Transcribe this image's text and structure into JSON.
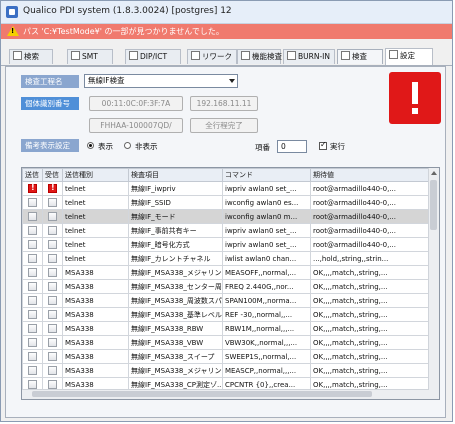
{
  "window": {
    "title": "Qualico PDI system (1.8.3.0024) [postgres] 12"
  },
  "alert": {
    "message": "パス 'C:¥TestMode¥' の一部が見つかりませんでした。"
  },
  "tabs": [
    {
      "label": "検索"
    },
    {
      "label": "SMT"
    },
    {
      "label": "DIP/ICT"
    },
    {
      "label": "リワーク"
    },
    {
      "label": "機能検査"
    },
    {
      "label": "BURN-IN"
    },
    {
      "label": "検査"
    },
    {
      "label": "設定"
    }
  ],
  "form": {
    "process_label": "検査工程名",
    "process_value": "無線IF検査",
    "individual_label": "個体識別番号",
    "mac_address": "00:11:0C:0F:3F:7A",
    "ip_address": "192.168.11.11",
    "serial": "FHHAA-100007QD/",
    "complete_button": "全行程完了",
    "note_label": "備考表示設定",
    "radio_show": "表示",
    "radio_hide": "非表示",
    "count_label": "項番",
    "count_value": "0",
    "run_label": "実行"
  },
  "colors": {
    "alert": "#f07a6e",
    "warning": "#e01818",
    "label_bg": "#8aa6cf"
  },
  "table": {
    "columns": [
      "送信",
      "受信",
      "送信種別",
      "検査項目",
      "コマンド",
      "期待値"
    ],
    "rows": [
      {
        "send_err": true,
        "type": "telnet",
        "item": "無線IF_iwpriv",
        "cmd": "iwpriv awlan0 set_...",
        "expect": "root@armadillo440-0,..."
      },
      {
        "send_err": false,
        "type": "telnet",
        "item": "無線IF_SSID",
        "cmd": "iwconfig awlan0 es...",
        "expect": "root@armadillo440-0,..."
      },
      {
        "send_err": false,
        "type": "telnet",
        "item": "無線IF_モード",
        "cmd": "iwconfig awlan0 m...",
        "expect": "root@armadillo440-0,..."
      },
      {
        "send_err": false,
        "type": "telnet",
        "item": "無線IF_事前共有キー",
        "cmd": "iwpriv awlan0 set_...",
        "expect": "root@armadillo440-0,..."
      },
      {
        "send_err": false,
        "type": "telnet",
        "item": "無線IF_暗号化方式",
        "cmd": "iwpriv awlan0 set_...",
        "expect": "root@armadillo440-0,..."
      },
      {
        "send_err": false,
        "type": "telnet",
        "item": "無線IF_カレントチャネル",
        "cmd": "iwlist awlan0 chan...",
        "expect": "...,hold,,string,,strin..."
      },
      {
        "send_err": false,
        "type": "MSA338",
        "item": "無線IF_MSA338_メジャリン...",
        "cmd": "MEASOFF,,normal,...",
        "expect": "OK,,,,match,,string,..."
      },
      {
        "send_err": false,
        "type": "MSA338",
        "item": "無線IF_MSA338_センター周波数",
        "cmd": "FREQ 2.440G,,nor...",
        "expect": "OK,,,,match,,string,..."
      },
      {
        "send_err": false,
        "type": "MSA338",
        "item": "無線IF_MSA338_周波数スパン",
        "cmd": "SPAN100M,,norma...",
        "expect": "OK,,,,match,,string,..."
      },
      {
        "send_err": false,
        "type": "MSA338",
        "item": "無線IF_MSA338_基準レベル",
        "cmd": "REF -30,,normal,,...",
        "expect": "OK,,,,match,,string,..."
      },
      {
        "send_err": false,
        "type": "MSA338",
        "item": "無線IF_MSA338_RBW",
        "cmd": "RBW1M,,normal,,,...",
        "expect": "OK,,,,match,,string,..."
      },
      {
        "send_err": false,
        "type": "MSA338",
        "item": "無線IF_MSA338_VBW",
        "cmd": "VBW30K,,normal,,,...",
        "expect": "OK,,,,match,,string,..."
      },
      {
        "send_err": false,
        "type": "MSA338",
        "item": "無線IF_MSA338_スイープ",
        "cmd": "SWEEP1S,,normal,...",
        "expect": "OK,,,,match,,string,..."
      },
      {
        "send_err": false,
        "type": "MSA338",
        "item": "無線IF_MSA338_メジャリン...",
        "cmd": "MEASCP,,normal,,,...",
        "expect": "OK,,,,match,,string,..."
      },
      {
        "send_err": false,
        "type": "MSA338",
        "item": "無線IF_MSA338_CP測定ゾ...",
        "cmd": "CPCNTR {0},,crea...",
        "expect": "OK,,,,match,,string,..."
      }
    ]
  }
}
